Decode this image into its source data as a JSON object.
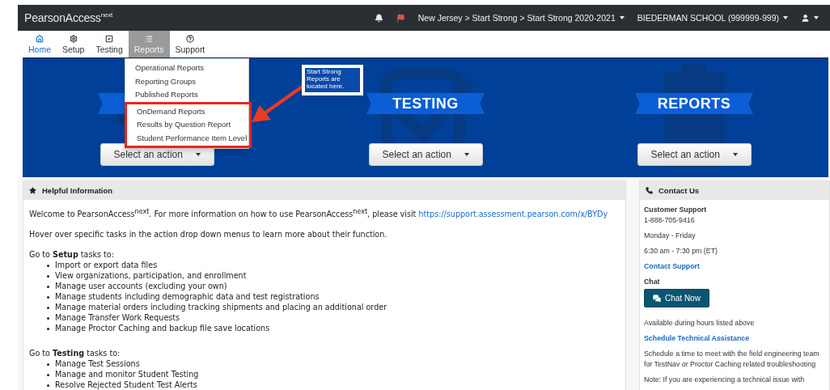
{
  "brand": {
    "name": "PearsonAccess",
    "superscript": "next"
  },
  "top_bar": {
    "context": "New Jersey > Start Strong > Start Strong 2020-2021",
    "organization": "BIEDERMAN SCHOOL (999999-999)"
  },
  "nav": [
    {
      "label": "Home",
      "current": true,
      "selected": false
    },
    {
      "label": "Setup",
      "current": false,
      "selected": false
    },
    {
      "label": "Testing",
      "current": false,
      "selected": false
    },
    {
      "label": "Reports",
      "current": false,
      "selected": true
    },
    {
      "label": "Support",
      "current": false,
      "selected": false
    }
  ],
  "reports_menu": [
    {
      "label": "Operational Reports",
      "highlighted": false
    },
    {
      "label": "Reporting Groups",
      "highlighted": false
    },
    {
      "label": "Published Reports",
      "highlighted": false
    },
    {
      "label": "OnDemand Reports",
      "highlighted": true
    },
    {
      "label": "Results by Question Report",
      "highlighted": true
    },
    {
      "label": "Student Performance Item Level",
      "highlighted": true
    }
  ],
  "callout": "Start Strong Reports are located here.",
  "tiles": [
    {
      "button": "Select an action"
    },
    {
      "title": "TESTING",
      "button": "Select an action"
    },
    {
      "title": "REPORTS",
      "button": "Select an action"
    }
  ],
  "helpful_information": {
    "title": "Helpful Information",
    "blocks": [
      {
        "kind": "paragraph",
        "text": "Welcome to PearsonAccess$^{next}$. For more information on how to use PearsonAccess$^{next}$, please visit",
        "link": "https://support.assessment.pearson.com/x/BYDy"
      },
      {
        "kind": "paragraph",
        "text": "Hover over specific tasks in the action drop down menus to learn more about their function."
      },
      {
        "kind": "list",
        "text": "Go to **Setup** tasks to:",
        "items": [
          "Import or export data files",
          "View organizations, participation, and enrollment",
          "Manage user accounts (excluding your own)",
          "Manage students including demographic data and test registrations",
          "Manage material orders including tracking shipments and placing an additional order",
          "Manage Transfer Work Requests",
          "Manage Proctor Caching and backup file save locations"
        ]
      },
      {
        "kind": "list",
        "text": "Go to **Testing** tasks to:",
        "items": [
          "Manage Test Sessions",
          "Manage and monitor Student Testing",
          "Resolve Rejected Student Test Alerts"
        ]
      }
    ]
  },
  "contact_us": {
    "title": "Contact Us",
    "items": [
      {
        "kind": "heading",
        "text": "Customer Support"
      },
      {
        "kind": "text",
        "text": "1-888-705-9416"
      },
      {
        "kind": "text",
        "text": "Monday - Friday"
      },
      {
        "kind": "text",
        "text": "6:30 am - 7:30 pm (ET)"
      },
      {
        "kind": "link",
        "text": "Contact Support"
      },
      {
        "kind": "heading",
        "text": "Chat"
      },
      {
        "kind": "button",
        "text": "Chat Now"
      },
      {
        "kind": "text",
        "text": "Available during hours listed above"
      },
      {
        "kind": "link",
        "text": "Schedule Technical Assistance"
      },
      {
        "kind": "text",
        "text": "Schedule a time to meet with the field engineering team for TestNav or Proctor Caching related troubleshooting"
      },
      {
        "kind": "text",
        "text": "Note: If you are experiencing a technical issue with"
      }
    ]
  }
}
